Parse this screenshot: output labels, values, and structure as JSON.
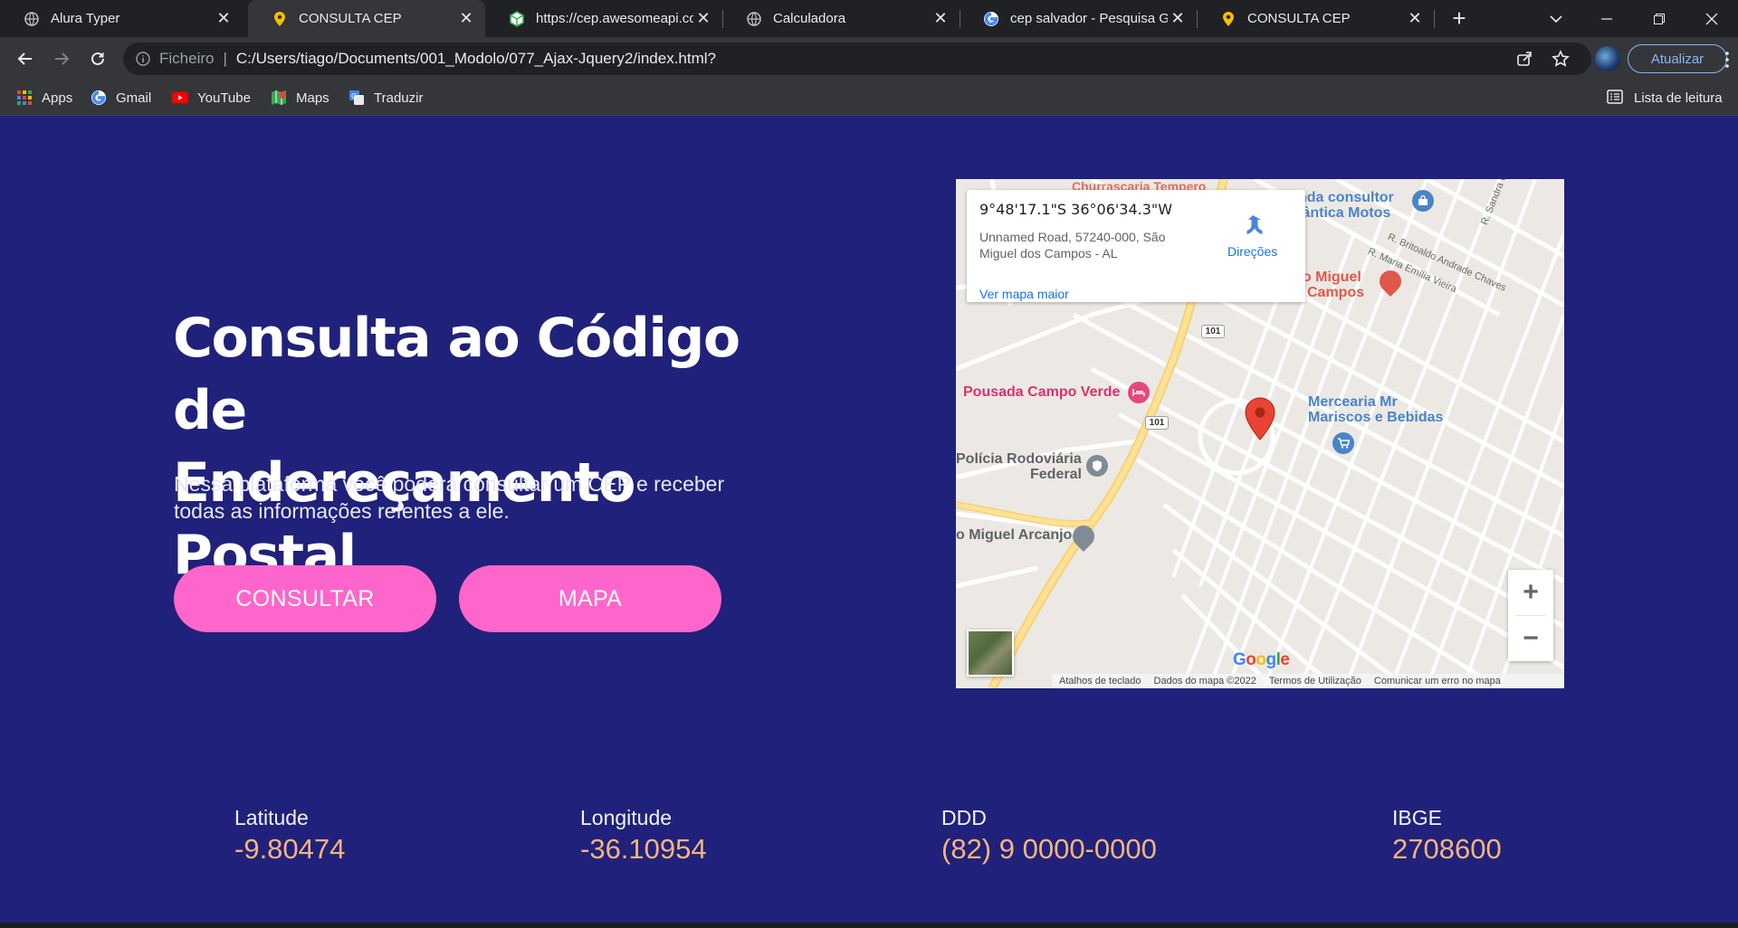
{
  "browser": {
    "tabs": [
      {
        "title": "Alura Typer",
        "favicon": "globe-icon",
        "active": false
      },
      {
        "title": "CONSULTA CEP",
        "favicon": "map-pin-icon",
        "active": true
      },
      {
        "title": "https://cep.awesomeapi.com",
        "favicon": "cube-icon",
        "active": false
      },
      {
        "title": "Calculadora",
        "favicon": "globe-icon",
        "active": false
      },
      {
        "title": "cep salvador - Pesquisa Google",
        "favicon": "google-icon",
        "active": false
      },
      {
        "title": "CONSULTA CEP",
        "favicon": "map-pin-icon",
        "active": false
      }
    ],
    "address_bar": {
      "scheme_label": "Ficheiro",
      "separator": "|",
      "url": "C:/Users/tiago/Documents/001_Modolo/077_Ajax-Jquery2/index.html?"
    },
    "update_label": "Atualizar",
    "bookmarks": [
      {
        "label": "Apps",
        "icon": "apps-grid-icon"
      },
      {
        "label": "Gmail",
        "icon": "google-icon"
      },
      {
        "label": "YouTube",
        "icon": "youtube-icon"
      },
      {
        "label": "Maps",
        "icon": "maps-icon"
      },
      {
        "label": "Traduzir",
        "icon": "translate-icon"
      }
    ],
    "reading_list_label": "Lista de leitura"
  },
  "hero": {
    "title_line1": "Consulta ao Código de",
    "title_line2": "Endereçamento Postal",
    "subtitle_line1": "Nessa plataforma você poderá consultar um CEP e receber",
    "subtitle_line2": "todas as informações refentes a ele.",
    "consult_label": "CONSULTAR",
    "map_label": "MAPA"
  },
  "map": {
    "coords": "9°48'17.1\"S 36°06'34.3\"W",
    "address": "Unnamed Road, 57240-000, São Miguel dos Campos - AL",
    "bigger_map_label": "Ver mapa maior",
    "directions_label": "Direções",
    "places": {
      "pousada": "Pousada Campo Verde",
      "policia_line1": "Polícia Rodoviária",
      "policia_line2": "Federal",
      "arcanjo": "o Miguel Arcanjo",
      "mercearia_line1": "Mercearia Mr",
      "mercearia_line2": "Mariscos e Bebidas",
      "motos_line1": "nda consultor",
      "motos_line2": "lântica Motos",
      "sao_miguel_line1": "ão Miguel",
      "sao_miguel_line2": "Campos",
      "churrascaria": "Churrascaria Tempero"
    },
    "streets": {
      "britoaldo": "R. Britoaldo Andrade Chaves",
      "maria_emilia": "R. Maria Emília Vieira",
      "sandra": "R. Sandra Ur"
    },
    "route_number": "101",
    "google_logo": "Google",
    "attribution": {
      "shortcuts": "Atalhos de teclado",
      "map_data": "Dados do mapa ©2022",
      "terms": "Termos de Utilização",
      "report": "Comunicar um erro no mapa"
    },
    "zoom_in": "+",
    "zoom_out": "−"
  },
  "stats": [
    {
      "label": "Latitude",
      "value": "-9.80474"
    },
    {
      "label": "Longitude",
      "value": "-36.10954"
    },
    {
      "label": "DDD",
      "value": "(82) 9 0000-0000"
    },
    {
      "label": "IBGE",
      "value": "2708600"
    }
  ],
  "colors": {
    "page_bg": "#20217a",
    "button_bg": "#ff66cc",
    "stat_value": "#f6b47e",
    "browser_frame": "#202124",
    "toolbar": "#35363a"
  }
}
